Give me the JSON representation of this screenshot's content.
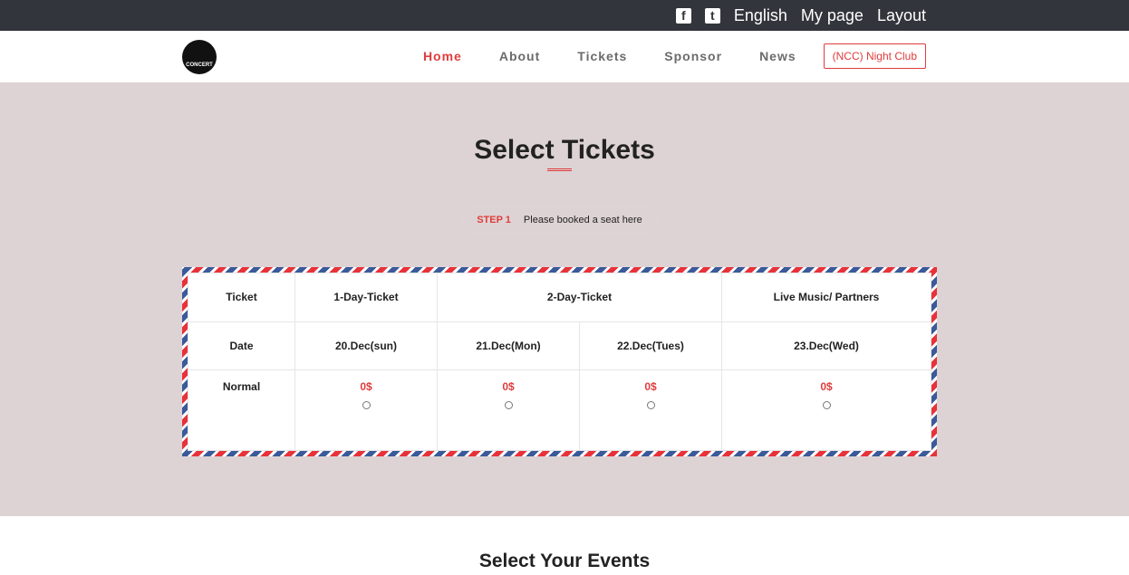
{
  "topbar": {
    "icons": [
      "facebook-icon",
      "twitter-icon"
    ],
    "links": [
      "English",
      "My page",
      "Layout"
    ]
  },
  "nav": {
    "logo_text": "CONCERT",
    "items": [
      "Home",
      "About",
      "Tickets",
      "Sponsor",
      "News"
    ],
    "active_index": 0,
    "cta": "(NCC) Night Club"
  },
  "main": {
    "title": "Select Tickets",
    "step": {
      "label": "STEP 1",
      "text": "Please booked a seat here"
    },
    "table": {
      "row_ticket": {
        "label": "Ticket",
        "cells": [
          "1-Day-Ticket",
          "2-Day-Ticket",
          "Live Music/ Partners"
        ]
      },
      "row_date": {
        "label": "Date",
        "cells": [
          "20.Dec(sun)",
          "21.Dec(Mon)",
          "22.Dec(Tues)",
          "23.Dec(Wed)"
        ]
      },
      "row_normal": {
        "label": "Normal",
        "prices": [
          "0$",
          "0$",
          "0$",
          "0$"
        ]
      }
    }
  },
  "events": {
    "title": "Select Your Events"
  },
  "colors": {
    "accent": "#e03c3c",
    "topbar_bg": "#33353c",
    "section_bg": "#ddd3d4"
  }
}
